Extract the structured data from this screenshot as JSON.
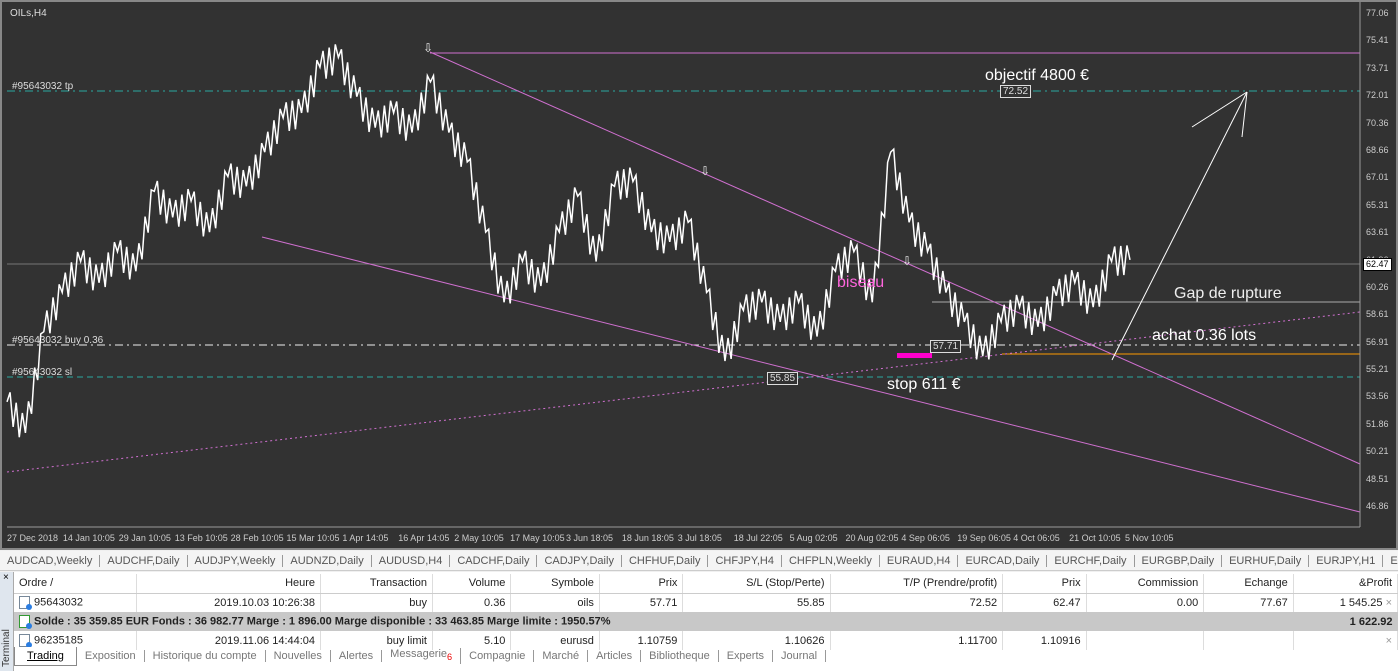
{
  "chart": {
    "title": "OILs,H4",
    "tp_label": "#95643032 tp",
    "buy_label": "#95643032 buy 0.36",
    "sl_label": "#95643032 sl",
    "objective": "objectif 4800 €",
    "tp_box": "72.52",
    "biseau": "biseau",
    "gap": "Gap de rupture",
    "achat": "achat 0.36 lots",
    "stop": "stop 611 €",
    "buy_box": "57.71",
    "sl_box": "55.85",
    "current_price": "62.47",
    "price_ticks": [
      "77.06",
      "75.41",
      "73.71",
      "72.01",
      "70.36",
      "68.66",
      "67.01",
      "65.31",
      "63.61",
      "61.96",
      "60.26",
      "58.61",
      "56.91",
      "55.21",
      "53.56",
      "51.86",
      "50.21",
      "48.51",
      "46.86"
    ],
    "date_ticks": [
      "27 Dec 2018",
      "14 Jan 10:05",
      "29 Jan 10:05",
      "13 Feb 10:05",
      "28 Feb 10:05",
      "15 Mar 10:05",
      "1 Apr 14:05",
      "16 Apr 14:05",
      "2 May 10:05",
      "17 May 10:05",
      "3 Jun 18:05",
      "18 Jun 18:05",
      "3 Jul 18:05",
      "18 Jul 22:05",
      "5 Aug 02:05",
      "20 Aug 02:05",
      "4 Sep 06:05",
      "19 Sep 06:05",
      "4 Oct 06:05",
      "21 Oct 10:05",
      "5 Nov 10:05"
    ],
    "price_series": [
      53.3,
      51.4,
      57.6,
      60.0,
      61.9,
      60.6,
      62.5,
      61.3,
      66.2,
      64.6,
      65.6,
      63.7,
      67.1,
      66.5,
      68.6,
      70.7,
      71.0,
      73.8,
      74.4,
      72.0,
      70.1,
      71.0,
      69.8,
      72.9,
      69.8,
      68.0,
      63.7,
      59.4,
      61.9,
      60.4,
      63.7,
      65.9,
      61.9,
      66.5,
      66.8,
      63.7,
      63.1,
      64.3,
      60.0,
      55.8,
      58.9,
      59.4,
      58.2,
      59.4,
      57.3,
      61.3,
      62.5,
      59.4,
      68.6,
      64.3,
      62.5,
      60.0,
      58.2,
      56.1,
      58.2,
      59.1,
      57.9,
      59.8,
      60.6,
      59.1,
      61.9,
      62.0
    ],
    "colors": {
      "background": "#323232",
      "price": "#ffffff",
      "wedge": "#d070d0",
      "tp": "#2aa8a0",
      "orange": "#ff9900",
      "magenta": "#ff00cc"
    }
  },
  "symbol_tabs": [
    "AUDCAD,Weekly",
    "AUDCHF,Daily",
    "AUDJPY,Weekly",
    "AUDNZD,Daily",
    "AUDUSD,H4",
    "CADCHF,Daily",
    "CADJPY,Daily",
    "CHFHUF,Daily",
    "CHFJPY,H4",
    "CHFPLN,Weekly",
    "EURAUD,H4",
    "EURCAD,Daily",
    "EURCHF,Daily",
    "EURGBP,Daily",
    "EURHUF,Daily",
    "EURJPY,H1",
    "EUI"
  ],
  "terminal": {
    "side_label": "Terminal",
    "columns": [
      "Ordre  /",
      "Heure",
      "Transaction",
      "Volume",
      "Symbole",
      "Prix",
      "S/L (Stop/Perte)",
      "T/P (Prendre/profit)",
      "Prix",
      "Commission",
      "Echange",
      "&Profit"
    ],
    "rows": [
      [
        "95643032",
        "2019.10.03 10:26:38",
        "buy",
        "0.36",
        "oils",
        "57.71",
        "55.85",
        "72.52",
        "62.47",
        "0.00",
        "77.67",
        "1 545.25"
      ],
      [
        "96235185",
        "2019.11.06 14:44:04",
        "buy limit",
        "5.10",
        "eurusd",
        "1.10759",
        "1.10626",
        "1.11700",
        "1.10916",
        "",
        "",
        ""
      ]
    ],
    "summary": "Solde : 35 359.85 EUR  Fonds : 36 982.77  Marge : 1 896.00  Marge disponible : 33 463.85  Marge limite : 1950.57%",
    "summary_profit": "1 622.92",
    "tabs": [
      "Trading",
      "Exposition",
      "Historique du compte",
      "Nouvelles",
      "Alertes",
      "Messagerie",
      "Compagnie",
      "Marché",
      "Articles",
      "Bibliotheque",
      "Experts",
      "Journal"
    ],
    "messagerie_badge": "6"
  }
}
